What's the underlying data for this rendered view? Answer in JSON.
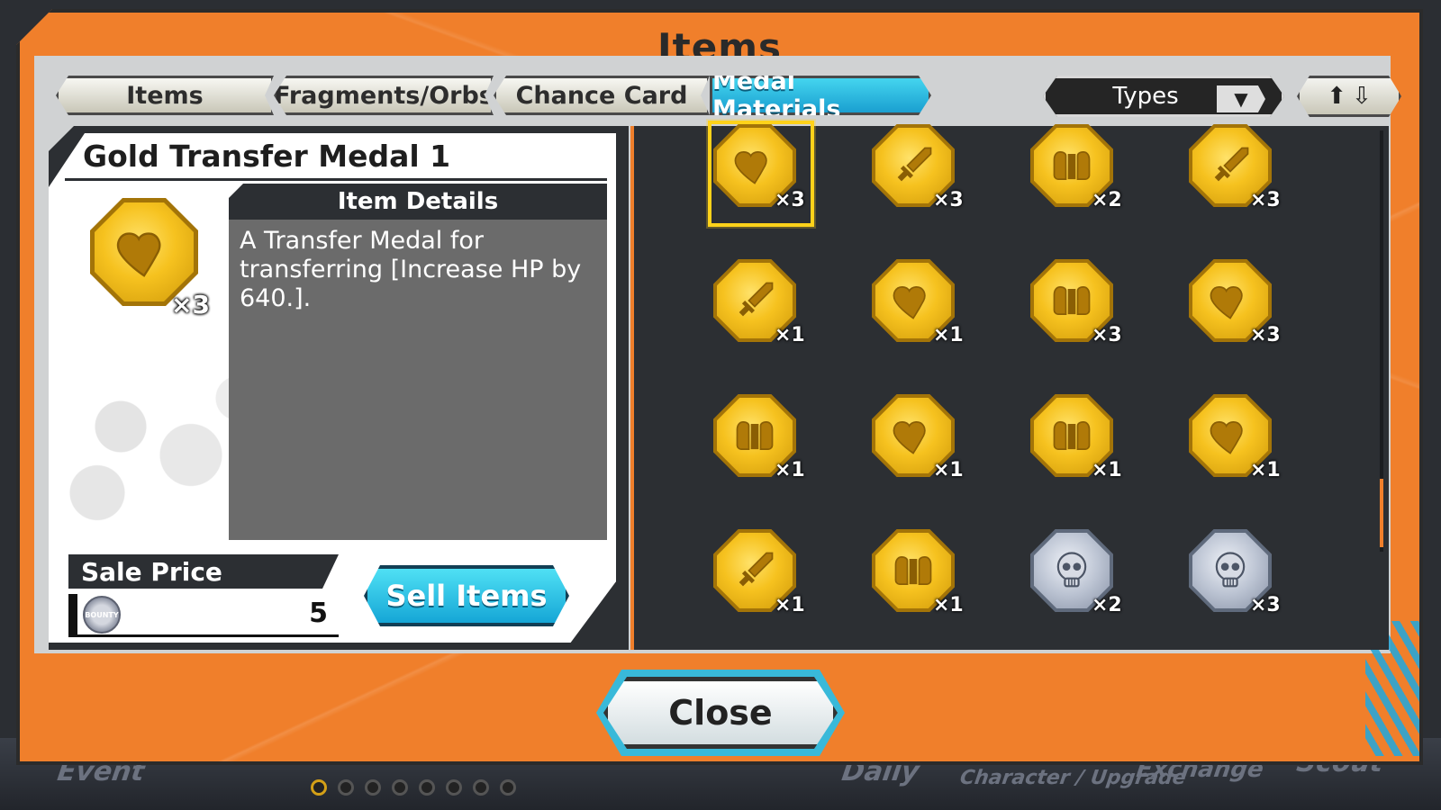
{
  "window": {
    "title": "Items"
  },
  "tabs": [
    {
      "label": "Items",
      "active": false
    },
    {
      "label": "Fragments/Orbs",
      "active": false
    },
    {
      "label": "Chance Card",
      "active": false
    },
    {
      "label": "Medal Materials",
      "active": true
    }
  ],
  "filter": {
    "types_label": "Types"
  },
  "detail": {
    "name": "Gold Transfer Medal 1",
    "quantity": "×3",
    "details_heading": "Item Details",
    "description": "A Transfer Medal for transferring [Increase HP by 640.].",
    "sale_price_label": "Sale Price",
    "sale_price_value": "5",
    "coin_text": "BOUNTY",
    "sell_button": "Sell Items"
  },
  "grid": [
    {
      "icon": "heart",
      "metal": "gold",
      "qty": "×3",
      "selected": true
    },
    {
      "icon": "sword",
      "metal": "gold",
      "qty": "×3"
    },
    {
      "icon": "armor",
      "metal": "gold",
      "qty": "×2"
    },
    {
      "icon": "sword",
      "metal": "gold",
      "qty": "×3"
    },
    {
      "icon": "sword",
      "metal": "gold",
      "qty": "×1"
    },
    {
      "icon": "heart",
      "metal": "gold",
      "qty": "×1"
    },
    {
      "icon": "armor",
      "metal": "gold",
      "qty": "×3"
    },
    {
      "icon": "heart",
      "metal": "gold",
      "qty": "×3"
    },
    {
      "icon": "armor",
      "metal": "gold",
      "qty": "×1"
    },
    {
      "icon": "heart",
      "metal": "gold",
      "qty": "×1"
    },
    {
      "icon": "armor",
      "metal": "gold",
      "qty": "×1"
    },
    {
      "icon": "heart",
      "metal": "gold",
      "qty": "×1"
    },
    {
      "icon": "sword",
      "metal": "gold",
      "qty": "×1"
    },
    {
      "icon": "armor",
      "metal": "gold",
      "qty": "×1"
    },
    {
      "icon": "skull",
      "metal": "silver",
      "qty": "×2"
    },
    {
      "icon": "skull",
      "metal": "silver",
      "qty": "×3"
    }
  ],
  "close_button": "Close",
  "background_nav": [
    "Event",
    "Daily",
    "Character / Upgrade",
    "Exchange",
    "Scout"
  ],
  "colors": {
    "panel": "#f07f2b",
    "accent": "#1aa6d6",
    "dark": "#2c2f33",
    "gold": "#f6c21f"
  }
}
